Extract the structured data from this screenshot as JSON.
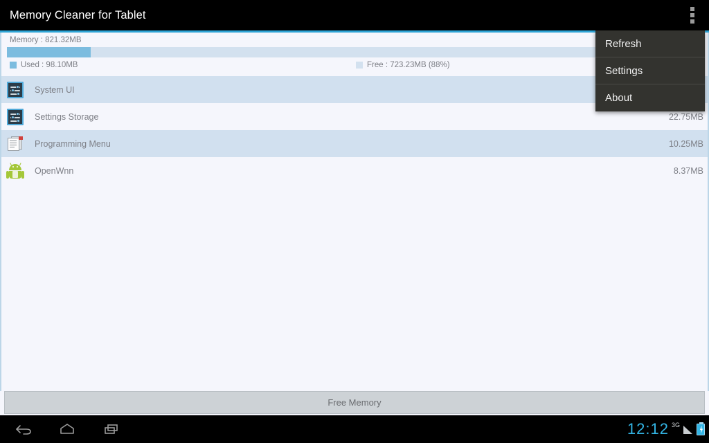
{
  "titlebar": {
    "app_title": "Memory Cleaner for Tablet",
    "overflow_icon": "overflow-dots-icon",
    "accent_color": "#2ea4d5"
  },
  "memory": {
    "total_label": "Memory : 821.32MB",
    "used_percent": 12,
    "legend": {
      "used_label": "Used : 98.10MB",
      "free_label": "Free : 723.23MB  (88%)",
      "used_color": "#7cbcdf",
      "free_color": "#d3e1ef"
    }
  },
  "applist": {
    "rows": [
      {
        "name": "System UI",
        "size": "",
        "icon": "settings-sliders-icon"
      },
      {
        "name": "Settings Storage",
        "size": "22.75MB",
        "icon": "settings-sliders-icon"
      },
      {
        "name": "Programming Menu",
        "size": "10.25MB",
        "icon": "document-stack-icon"
      },
      {
        "name": "OpenWnn",
        "size": "8.37MB",
        "icon": "android-robot-icon"
      }
    ]
  },
  "footer": {
    "free_memory_label": "Free Memory"
  },
  "popup_menu": {
    "items": [
      {
        "label": "Refresh"
      },
      {
        "label": "Settings"
      },
      {
        "label": "About"
      }
    ]
  },
  "navbar": {
    "back_icon": "back-arrow-icon",
    "home_icon": "home-icon",
    "recents_icon": "recents-icon",
    "status": {
      "clock": "12:12",
      "network": "3G",
      "signal_icon": "signal-bars-icon",
      "battery_icon": "battery-charging-icon",
      "accent_color": "#33b5e5"
    }
  }
}
